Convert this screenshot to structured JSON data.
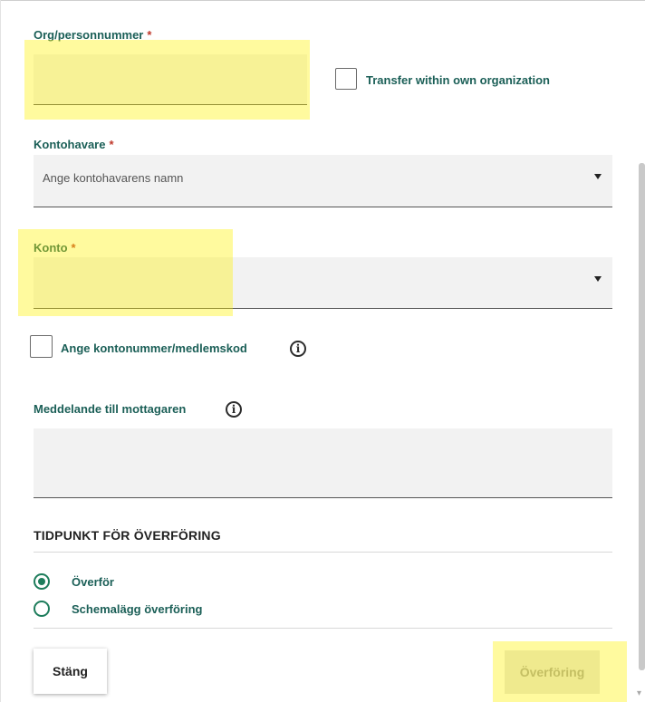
{
  "form": {
    "org_label": "Org/personnummer",
    "required_mark": "*",
    "org_value": "",
    "transfer_own_label": "Transfer within own organization",
    "holder_label": "Kontohavare",
    "holder_placeholder": "Ange kontohavarens namn",
    "account_label": "Konto",
    "account_value": "",
    "enter_account_label": "Ange kontonummer/medlemskod",
    "message_label": "Meddelande till mottagaren",
    "message_value": ""
  },
  "timing": {
    "title": "TIDPUNKT FÖR ÖVERFÖRING",
    "options": [
      {
        "label": "Överför",
        "selected": true
      },
      {
        "label": "Schemalägg överföring",
        "selected": false
      }
    ]
  },
  "buttons": {
    "close": "Stäng",
    "transfer": "Överföring"
  },
  "colors": {
    "label_green": "#1b5f57",
    "radio_green": "#1e7d5c",
    "required_red": "#c0392b",
    "highlight_yellow": "#fff200"
  }
}
